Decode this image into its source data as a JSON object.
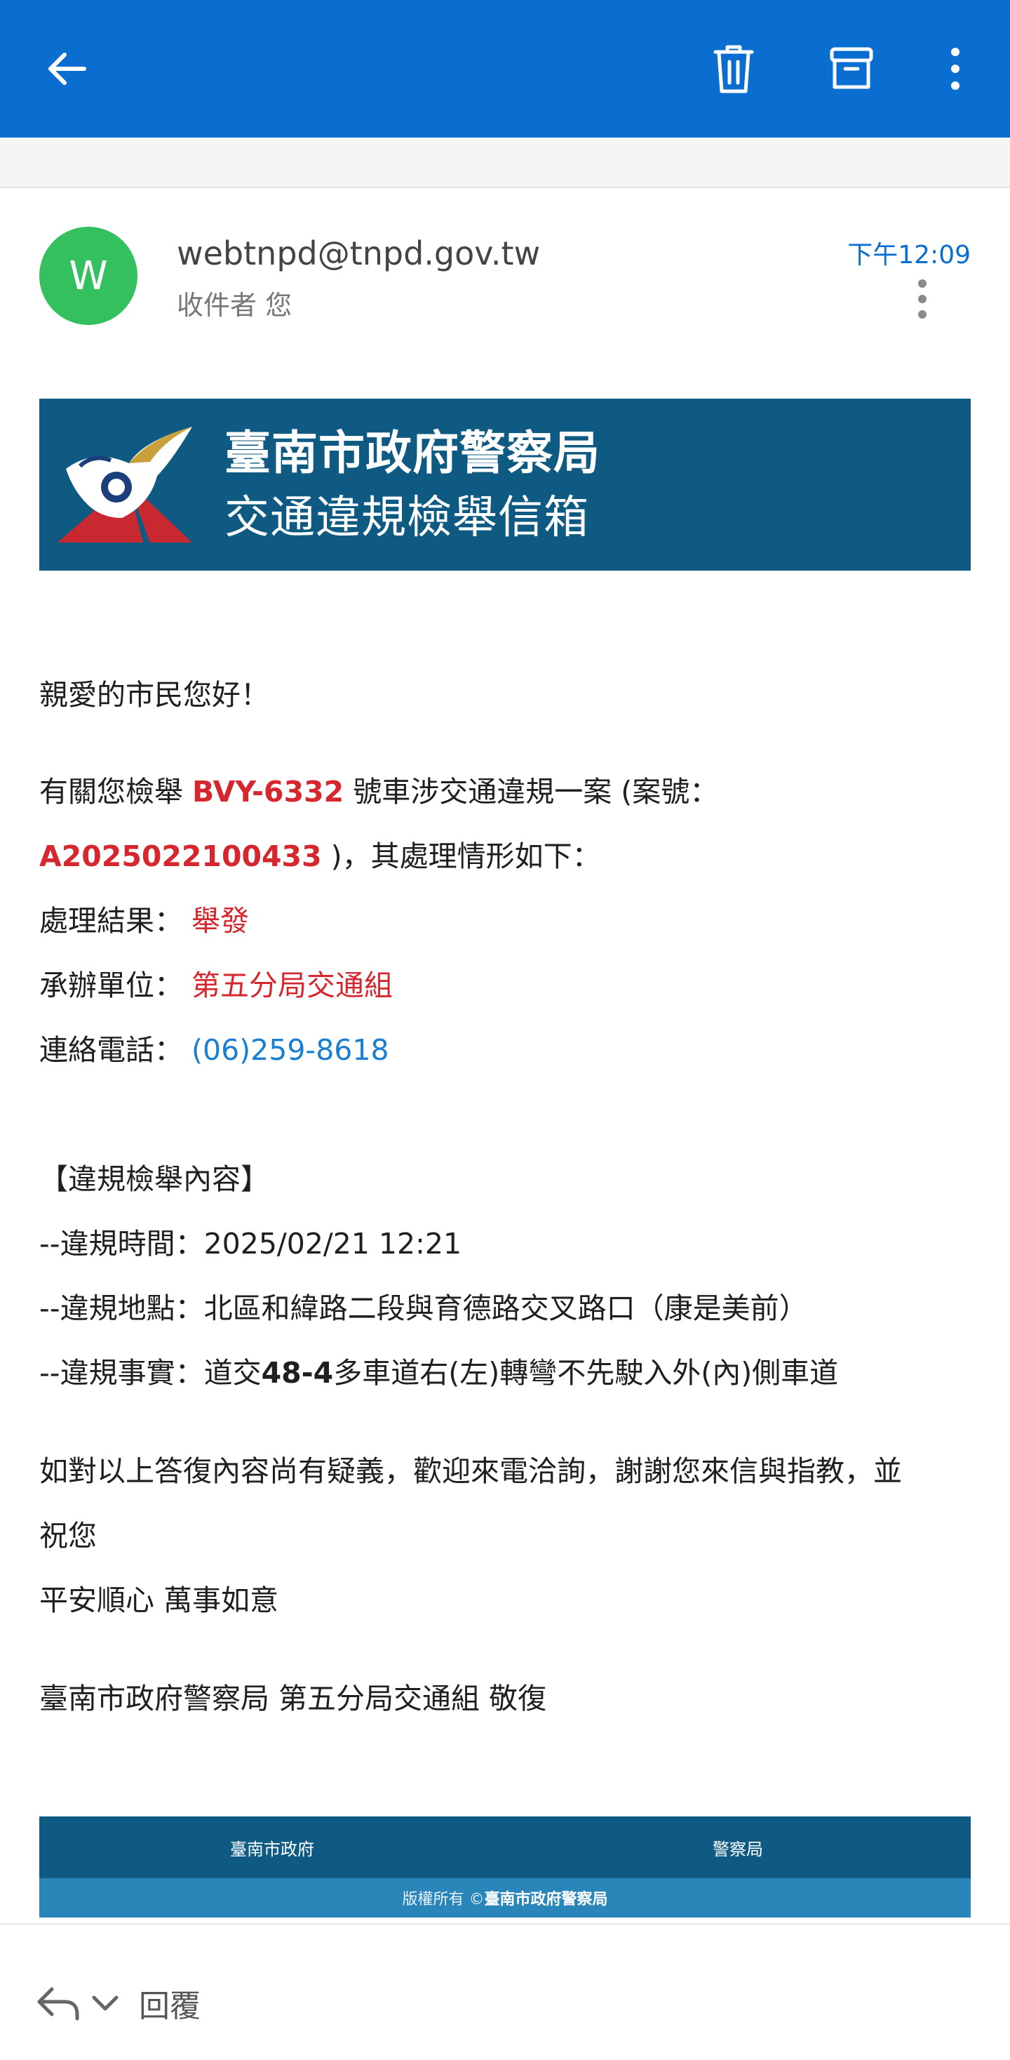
{
  "toolbar": {
    "back_icon": "arrow-left-icon",
    "delete_icon": "trash-icon",
    "archive_icon": "archive-icon",
    "more_icon": "more-vertical-icon"
  },
  "message": {
    "avatar_letter": "W",
    "sender": "webtnpd@tnpd.gov.tw",
    "recipient": "收件者 您",
    "time": "下午12:09"
  },
  "banner": {
    "title": "臺南市政府警察局",
    "subtitle": "交通違規檢舉信箱"
  },
  "content": {
    "greeting": "親愛的市民您好！",
    "intro_prefix": "有關您檢舉 ",
    "plate": "BVY-6332",
    "intro_suffix": " 號車涉交通違規一案 (案號：",
    "case_no": "A2025022100433",
    "case_suffix": " )，其處理情形如下：",
    "result_label": "處理結果：",
    "result_value": "舉發",
    "unit_label": "承辦單位：",
    "unit_value": "第五分局交通組",
    "phone_label": "連絡電話：",
    "phone_value": "(06)259-8618",
    "section_header": "【違規檢舉內容】",
    "time_label": "--違規時間：",
    "time_value": "2025/02/21 12:21",
    "place_label": "--違規地點：",
    "place_value": "北區和緯路二段與育德路交叉路口（康是美前）",
    "fact_label": "--違規事實：",
    "fact_pre": "道交",
    "fact_code": "48-4",
    "fact_post": "多車道右(左)轉彎不先駛入外(內)側車道",
    "closing_line1": "如對以上答復內容尚有疑義，歡迎來電洽詢，謝謝您來信與指教，並",
    "closing_line2": "祝您",
    "closing_line3": "平安順心 萬事如意",
    "signature": "臺南市政府警察局 第五分局交通組 敬復"
  },
  "footer": {
    "link_left": "臺南市政府",
    "link_right": "警察局",
    "copyright_prefix": "版權所有 © ",
    "copyright_org": "臺南市政府警察局"
  },
  "bottom": {
    "reply_label": "回覆"
  },
  "colors": {
    "topbar": "#0a6ed1",
    "banner": "#0e5a82",
    "highlight_red": "#d6262e",
    "link_blue": "#1a7fd0",
    "avatar": "#35c060"
  }
}
